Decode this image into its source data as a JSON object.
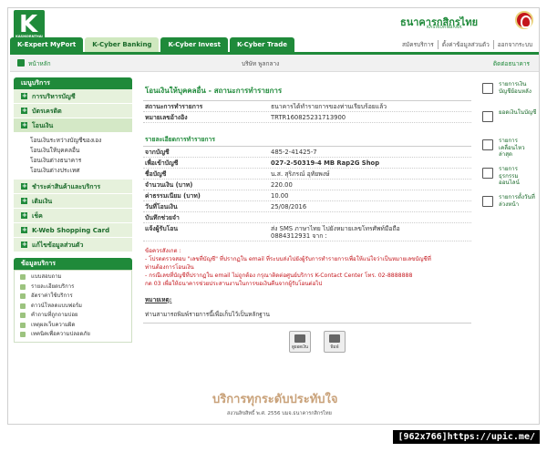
{
  "logo": {
    "letter": "K",
    "sub": "KASIKORNTHAI"
  },
  "bank": {
    "name_th": "ธนาคารกสิกรไทย",
    "name_en": "KASIKORNBANK"
  },
  "tabs": [
    "K-Expert MyPort",
    "K-Cyber Banking",
    "K-Cyber Invest",
    "K-Cyber Trade"
  ],
  "top_links": [
    "สมัครบริการ",
    "ตั้งค่าข้อมูลส่วนตัว",
    "ออกจากระบบ"
  ],
  "subheader": {
    "home": "หน้าหลัก",
    "company": "บริษัท พูลกลาง",
    "contact": "ติดต่อธนาคาร"
  },
  "sidebar": {
    "header": "เมนูบริการ",
    "items": [
      {
        "label": "การบริหารบัญชี"
      },
      {
        "label": "บัตรเครดิต"
      },
      {
        "label": "โอนเงิน"
      },
      {
        "label": "ชำระค่าสินค้าและบริการ"
      },
      {
        "label": "เติมเงิน"
      },
      {
        "label": "เช็ค"
      },
      {
        "label": "K-Web Shopping Card"
      },
      {
        "label": "แก้ไขข้อมูลส่วนตัว"
      }
    ],
    "transfer_sub": [
      "โอนเงินระหว่างบัญชีของเอง",
      "โอนเงินให้บุคคลอื่น",
      "โอนเงินต่างธนาคาร",
      "โอนเงินต่างประเทศ"
    ],
    "services_header": "ข้อมูลบริการ",
    "services": [
      "แบบสอบถาม",
      "รายละเอียดบริการ",
      "อัตราค่าใช้บริการ",
      "ดาวน์โหลดแบบฟอร์ม",
      "คำถามที่ถูกถามบ่อย",
      "เหตุผลเว็บความผิด",
      "เทคนิคเพื่อความปลอดภัย"
    ]
  },
  "main": {
    "title": "โอนเงินให้บุคคลอื่น - สถานะการทำรายการ",
    "status_label": "สถานะการทำรายการ",
    "status_value": "ธนาคารได้ทำรายการของท่านเรียบร้อยแล้ว",
    "ref_label": "หมายเลขอ้างอิง",
    "ref_value": "TRTR160825231713900",
    "section": "รายละเอียดการทำรายการ",
    "details": [
      {
        "k": "จากบัญชี",
        "v": "485-2-41425-7",
        "b": false
      },
      {
        "k": "เพื่อเข้าบัญชี",
        "v": "027-2-50319-4 MB Rap2G Shop",
        "b": true
      },
      {
        "k": "ชื่อบัญชี",
        "v": "น.ส. สุริภรณ์ อุทัยพงษ์",
        "b": false
      },
      {
        "k": "จำนวนเงิน (บาท)",
        "v": "220.00",
        "b": false
      },
      {
        "k": "ค่าธรรมเนียม (บาท)",
        "v": "10.00",
        "b": false
      },
      {
        "k": "วันที่โอนเงิน",
        "v": "25/08/2016",
        "b": false
      },
      {
        "k": "บันทึกช่วยจำ",
        "v": "",
        "b": false
      },
      {
        "k": "แจ้งผู้รับโอน",
        "v": "ส่ง SMS ภาษาไทย ไปยังหมายเลขโทรศัพท์มือถือ 0884312931 จาก :",
        "b": false
      }
    ],
    "warning": "ข้อควรสังเกต :\n  - โปรดตรวจสอบ \"เลขที่บัญชี\" ที่ปรากฏใน email ที่ระบบส่งไปยังผู้รับการทำรายการเพื่อให้แน่ใจว่าเป็นหมายเลขบัญชีที่\n    ท่านต้องการโอนเงิน\n  - กรณีเลขที่บัญชีที่ปรากฏใน email ไม่ถูกต้อง กรุณาติดต่อศูนย์บริการ K-Contact Center โทร. 02-8888888\n    กด 03 เพื่อให้ธนาคารช่วยประสานงานในการขอเงินคืนจากผู้รับโอนต่อไป",
    "note_title": "หมายเหตุ:",
    "note": "ท่านสามารถพิมพ์รายการนี้เพื่อเก็บไว้เป็นหลักฐาน",
    "buttons": [
      "ดูยอดเงิน",
      "พิมพ์"
    ]
  },
  "right_links": [
    "รายการเงิน บัญชีย้อนหลัง",
    "ยอดเงินในบัญชี",
    "รายการ เคลื่อนไหวล่าสุด",
    "รายการ ธุรกรรมออนไลน์",
    "รายการตั้งวันที่ ล่วงหน้า"
  ],
  "footer": {
    "slogan": "บริการทุกระดับประทับใจ",
    "copyright": "สงวนลิขสิทธิ์ พ.ศ. 2556 บมจ.ธนาคารกสิกรไทย"
  },
  "watermark": "[962x766]https://upic.me/"
}
